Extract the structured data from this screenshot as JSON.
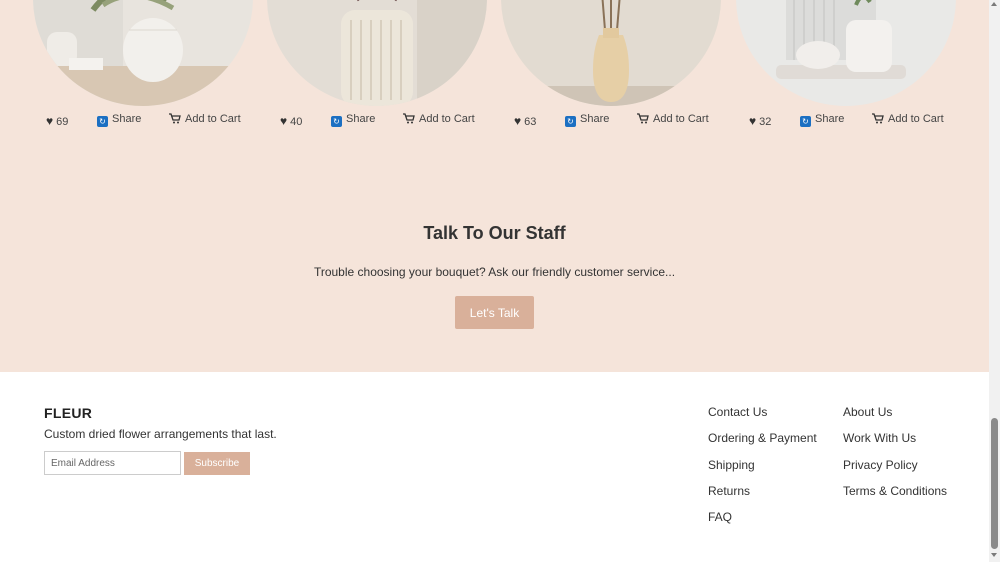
{
  "products": [
    {
      "likes": "69",
      "share_label": "Share",
      "cart_label": "Add to Cart"
    },
    {
      "likes": "40",
      "share_label": "Share",
      "cart_label": "Add to Cart"
    },
    {
      "likes": "63",
      "share_label": "Share",
      "cart_label": "Add to Cart"
    },
    {
      "likes": "32",
      "share_label": "Share",
      "cart_label": "Add to Cart"
    }
  ],
  "talk": {
    "title": "Talk To Our Staff",
    "subtitle": "Trouble choosing your bouquet? Ask our friendly customer service...",
    "button": "Let's Talk"
  },
  "footer": {
    "brand": "FLEUR",
    "tagline": "Custom dried flower arrangements that last.",
    "email_placeholder": "Email Address",
    "subscribe": "Subscribe",
    "col1": [
      "Contact Us",
      "Ordering & Payment",
      "Shipping",
      "Returns",
      "FAQ"
    ],
    "col2": [
      "About Us",
      "Work With Us",
      "Privacy Policy",
      "Terms & Conditions"
    ]
  },
  "colors": {
    "section_bg": "#f5e4da",
    "accent": "#d9b09a"
  },
  "icons": [
    "heart-icon",
    "share-icon",
    "cart-icon"
  ]
}
